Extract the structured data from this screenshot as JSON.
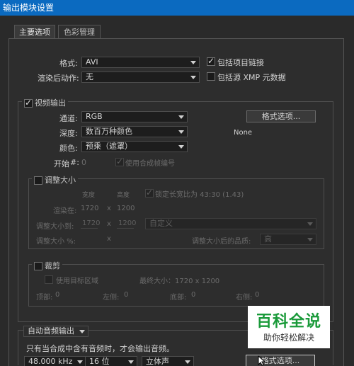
{
  "window": {
    "title": "输出模块设置"
  },
  "tabs": [
    {
      "label": "主要选项"
    },
    {
      "label": "色彩管理"
    }
  ],
  "main": {
    "format_label": "格式:",
    "format_value": "AVI",
    "post_render_label": "渲染后动作:",
    "post_render_value": "无",
    "include_project_link": "包括项目链接",
    "include_xmp": "包括源 XMP 元数据"
  },
  "video": {
    "enable_label": "视频输出",
    "channels_label": "通道:",
    "channels_value": "RGB",
    "depth_label": "深度:",
    "depth_value": "数百万种颜色",
    "color_label": "颜色:",
    "color_value": "预乘（遮罩）",
    "format_options_button": "格式选项...",
    "codec_text": "None",
    "start_label": "开始",
    "start_hash_label": "#:",
    "start_value": "0",
    "use_comp_frame_label": "使用合成帧编号"
  },
  "resize": {
    "title": "调整大小",
    "width_header": "宽度",
    "height_header": "高度",
    "lock_aspect_label": "锁定长宽比为 43:30 (1.43)",
    "render_at_label": "渲染在:",
    "render_w": "1720",
    "render_x": "x",
    "render_h": "1200",
    "resize_to_label": "调整大小到:",
    "resize_w": "1720",
    "resize_x": "x",
    "resize_h": "1200",
    "preset_value": "自定义",
    "percent_label": "调整大小 %:",
    "percent_x": "x",
    "quality_label": "调整大小后的品质:",
    "quality_value": "高"
  },
  "crop": {
    "title": "裁剪",
    "use_roi_label": "使用目标区域",
    "max_size_label": "最终大小：1720 x 1200",
    "top_label": "顶部:",
    "top_value": "0",
    "left_label": "左侧:",
    "left_value": "0",
    "bottom_label": "底部:",
    "bottom_value": "0",
    "right_label": "右侧:",
    "right_value": "0"
  },
  "audio": {
    "mode_value": "自动音频输出",
    "info_text": "只有当合成中含有音频时，才会输出音频。",
    "rate_value": "48.000 kHz",
    "bits_value": "16 位",
    "channels_value": "立体声",
    "format_options_button": "格式选项..."
  },
  "watermark": {
    "logo_text": "百科全说",
    "sub_text": "助你轻松解决"
  }
}
